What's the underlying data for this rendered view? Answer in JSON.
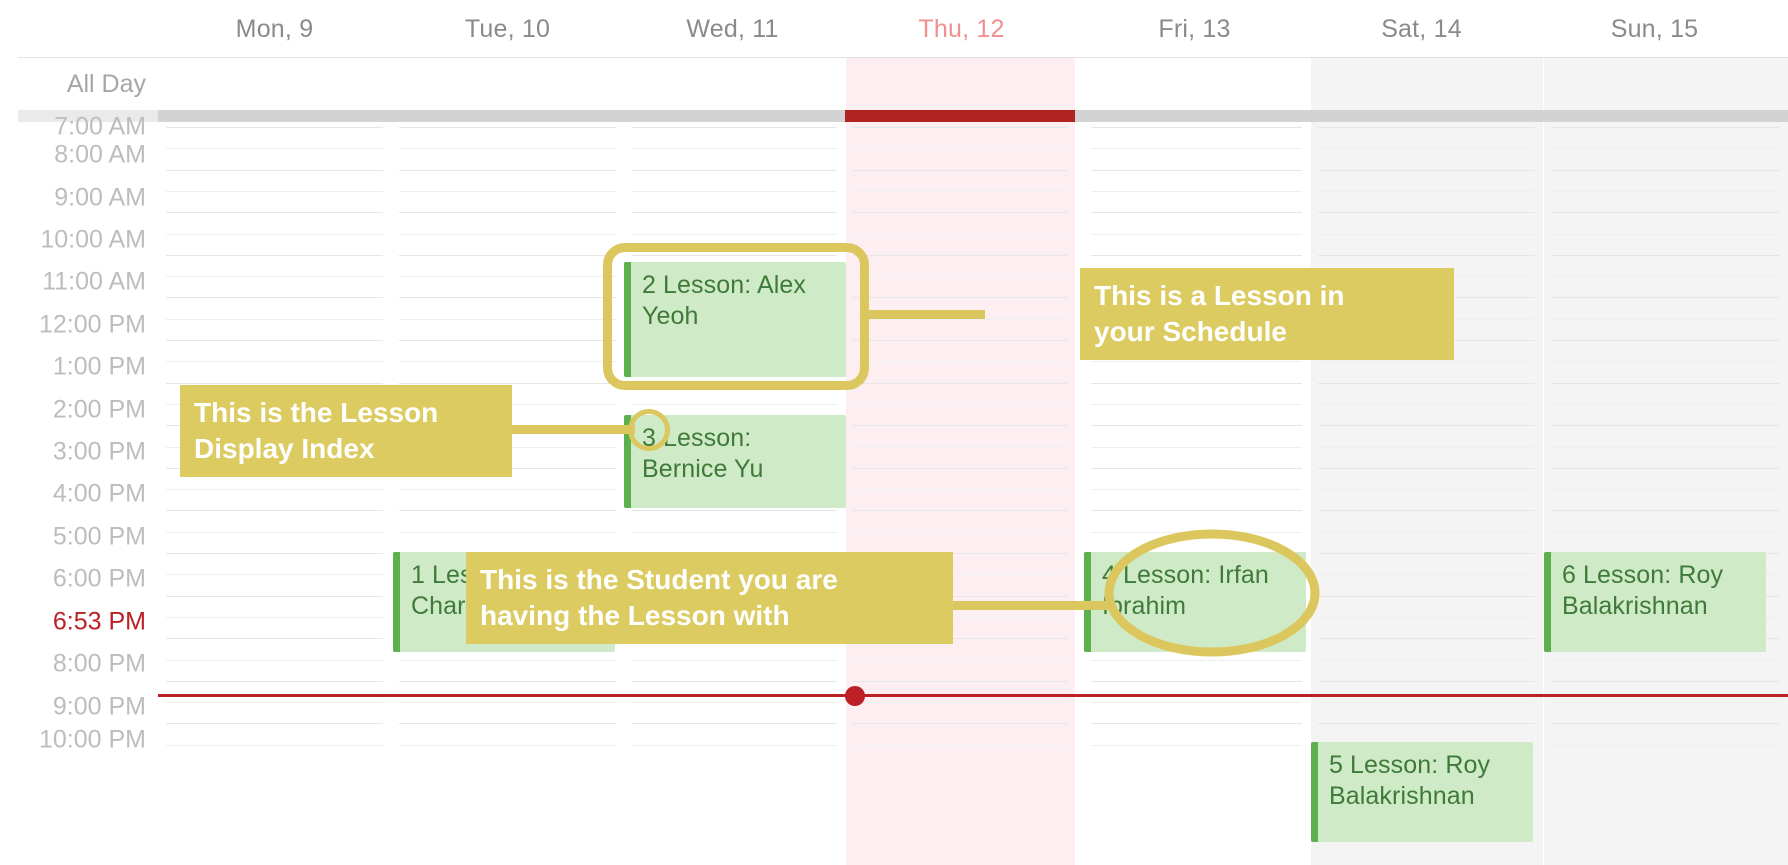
{
  "calendar": {
    "all_day_label": "All Day",
    "days": [
      {
        "label": "Mon, 9",
        "is_today": false,
        "is_weekend": false
      },
      {
        "label": "Tue, 10",
        "is_today": false,
        "is_weekend": false
      },
      {
        "label": "Wed, 11",
        "is_today": false,
        "is_weekend": false
      },
      {
        "label": "Thu, 12",
        "is_today": true,
        "is_weekend": false
      },
      {
        "label": "Fri, 13",
        "is_today": false,
        "is_weekend": false
      },
      {
        "label": "Sat, 14",
        "is_today": false,
        "is_weekend": true
      },
      {
        "label": "Sun, 15",
        "is_today": false,
        "is_weekend": true
      }
    ],
    "time_labels": [
      "7:00 AM",
      "8:00 AM",
      "9:00 AM",
      "10:00 AM",
      "11:00 AM",
      "12:00 PM",
      "1:00 PM",
      "2:00 PM",
      "3:00 PM",
      "4:00 PM",
      "5:00 PM",
      "6:00 PM",
      "8:00 PM",
      "9:00 PM",
      "10:00 PM"
    ],
    "current_time_label": "6:53 PM",
    "events": [
      {
        "index": "2",
        "text": "2 Lesson: Alex Yeoh",
        "day": "Wed, 11",
        "student": "Alex Yeoh"
      },
      {
        "index": "3",
        "text": "3 Lesson: Bernice Yu",
        "day": "Wed, 11",
        "student": "Bernice Yu"
      },
      {
        "index": "1",
        "text": "1 Lesson: Charlotte Ibrahim",
        "day": "Tue, 10",
        "student": "Charlotte Ibrahim"
      },
      {
        "index": "4",
        "text": "4 Lesson: Irfan Ibrahim",
        "day": "Fri, 13",
        "student": "Irfan Ibrahim"
      },
      {
        "index": "6",
        "text": "6 Lesson: Roy Balakrishnan",
        "day": "Sun, 15",
        "student": "Roy Balakrishnan"
      },
      {
        "index": "5",
        "text": "5 Lesson: Roy Balakrishnan",
        "day": "Sat, 14",
        "student": "Roy Balakrishnan"
      }
    ],
    "annotations": [
      {
        "id": "lesson",
        "text": "This is a Lesson in\nyour Schedule"
      },
      {
        "id": "index",
        "text": "This is the Lesson\nDisplay Index"
      },
      {
        "id": "student",
        "text": "This is the Student you are\nhaving the Lesson with"
      }
    ],
    "colors": {
      "annotation": "#dccb61",
      "event_bg": "#cfeac6",
      "event_accent": "#5cb04e",
      "event_text": "#3f7a3a",
      "today_tint": "#fdeef1",
      "today_header": "#ef8f8f",
      "now_red": "#bb2025",
      "weekend_tint": "#f4f4f4"
    }
  }
}
